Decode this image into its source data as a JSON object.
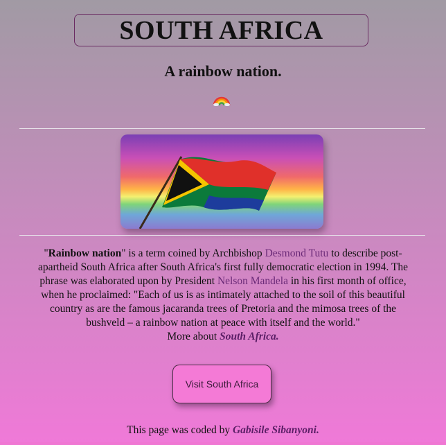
{
  "header": {
    "title": "SOUTH AFRICA",
    "subtitle": "A rainbow nation."
  },
  "icons": {
    "rainbow": "rainbow-emoji"
  },
  "description": {
    "term_open_quote": "\"",
    "term": "Rainbow nation",
    "term_close_quote": "\"",
    "text_1": " is a term coined by Archbishop ",
    "link_tutu": "Desmond Tutu",
    "text_2": " to describe post-apartheid South Africa after South Africa's first fully democratic election in 1994. The phrase was elaborated upon by President ",
    "link_mandela": "Nelson Mandela",
    "text_3": " in his first month of office, when he proclaimed: \"Each of us is as intimately attached to the soil of this beautiful country as are the famous jacaranda trees of Pretoria and the mimosa trees of the bushveld – a rainbow nation at peace with itself and the world.\"",
    "more_prefix": "More about ",
    "more_link": "South Africa."
  },
  "button": {
    "label": "Visit South Africa"
  },
  "footer": {
    "prefix": "This page was coded by ",
    "author": "Gabisile Sibanyoni."
  },
  "colors": {
    "background_top": "#a19aa4",
    "background_bottom": "#f079d8",
    "button": "#f47ad6",
    "link": "#6b2a78"
  }
}
